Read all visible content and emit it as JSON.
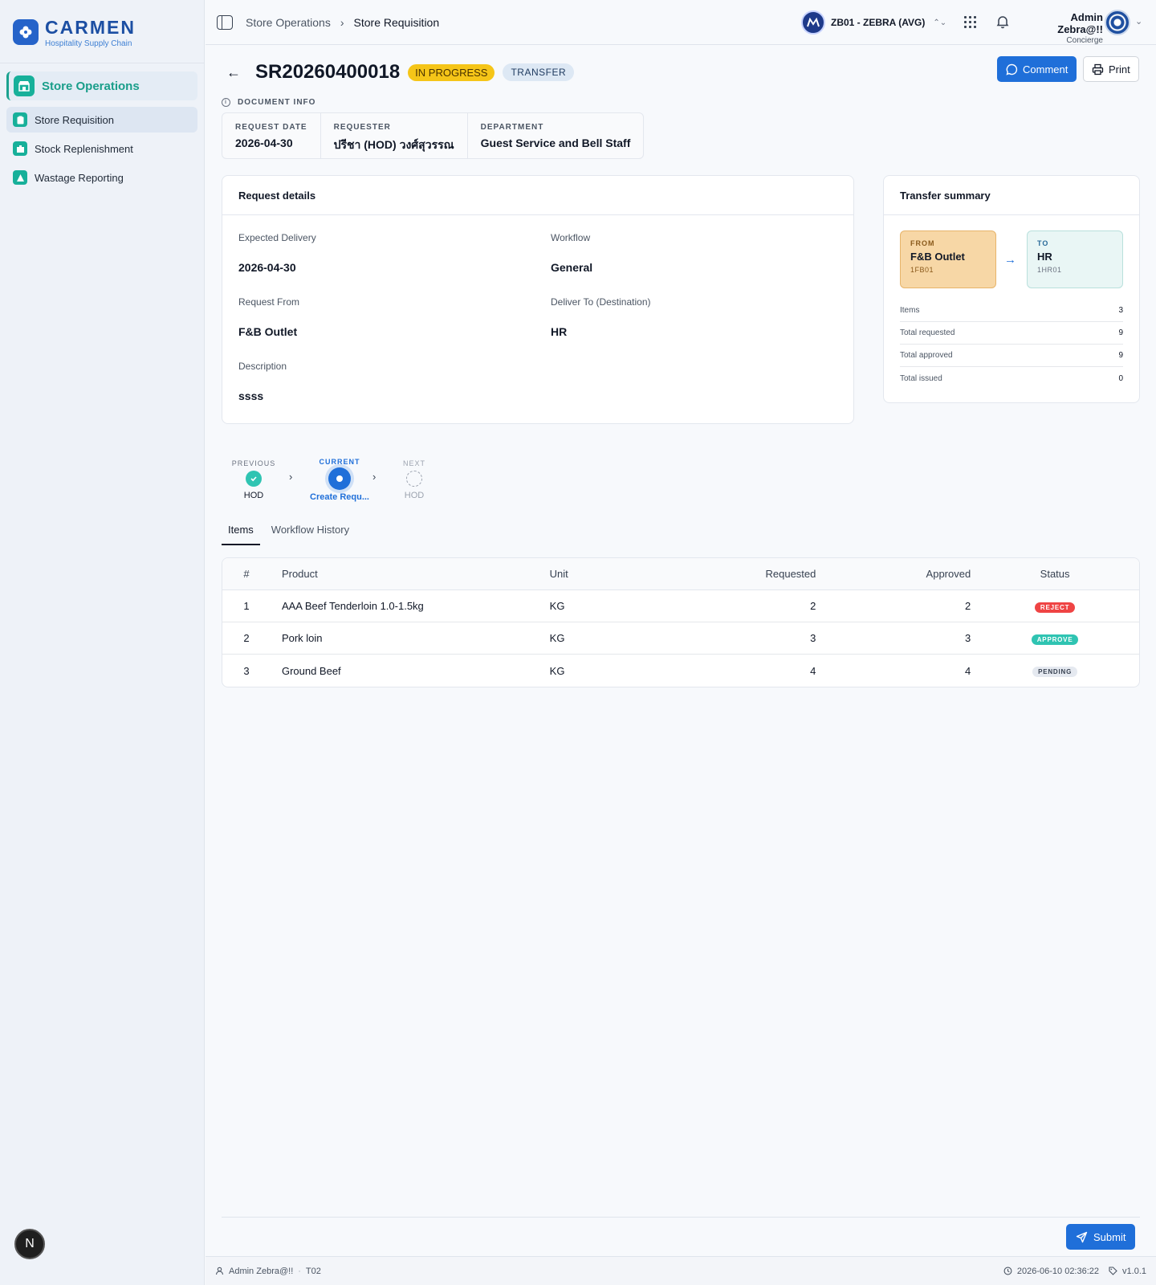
{
  "brand": {
    "name": "CARMEN",
    "subtitle": "Hospitality Supply Chain"
  },
  "sidebar": {
    "module": "Store Operations",
    "items": [
      {
        "label": "Store Requisition",
        "icon": "clipboard-icon",
        "active": true
      },
      {
        "label": "Stock Replenishment",
        "icon": "box-icon",
        "active": false
      },
      {
        "label": "Wastage Reporting",
        "icon": "warning-icon",
        "active": false
      }
    ],
    "avatar_letter": "N"
  },
  "topbar": {
    "breadcrumb": [
      "Store Operations",
      "Store Requisition"
    ],
    "company": "ZB01 - ZEBRA (AVG)",
    "user_name": "Admin Zebra@!!",
    "user_role": "Concierge"
  },
  "document": {
    "number": "SR20260400018",
    "status": "IN PROGRESS",
    "type": "TRANSFER",
    "comment_label": "Comment",
    "print_label": "Print",
    "info_title": "DOCUMENT INFO",
    "info": [
      {
        "label": "REQUEST DATE",
        "value": "2026-04-30"
      },
      {
        "label": "REQUESTER",
        "value": "ปรีชา (HOD) วงศ์สุวรรณ"
      },
      {
        "label": "DEPARTMENT",
        "value": "Guest Service and Bell Staff"
      }
    ]
  },
  "request_details": {
    "title": "Request details",
    "fields": [
      {
        "label": "Expected Delivery",
        "value": "2026-04-30"
      },
      {
        "label": "Workflow",
        "value": "General"
      },
      {
        "label": "Request From",
        "value": "F&B Outlet"
      },
      {
        "label": "Deliver To (Destination)",
        "value": "HR"
      },
      {
        "label": "Description",
        "value": "ssss"
      }
    ]
  },
  "transfer_summary": {
    "title": "Transfer summary",
    "from": {
      "label": "FROM",
      "name": "F&B Outlet",
      "code": "1FB01"
    },
    "to": {
      "label": "TO",
      "name": "HR",
      "code": "1HR01"
    },
    "rows": [
      {
        "label": "Items",
        "value": "3"
      },
      {
        "label": "Total requested",
        "value": "9"
      },
      {
        "label": "Total approved",
        "value": "9"
      },
      {
        "label": "Total issued",
        "value": "0"
      }
    ]
  },
  "workflow": {
    "previous": {
      "label": "PREVIOUS",
      "name": "HOD"
    },
    "current": {
      "label": "CURRENT",
      "name": "Create Requ..."
    },
    "next": {
      "label": "NEXT",
      "name": "HOD"
    }
  },
  "tabs": [
    "Items",
    "Workflow History"
  ],
  "items_table": {
    "headers": [
      "#",
      "Product",
      "Unit",
      "Requested",
      "Approved",
      "Status"
    ],
    "rows": [
      {
        "num": "1",
        "product": "AAA Beef Tenderloin 1.0-1.5kg",
        "unit": "KG",
        "requested": "2",
        "approved": "2",
        "status": "REJECT"
      },
      {
        "num": "2",
        "product": "Pork loin",
        "unit": "KG",
        "requested": "3",
        "approved": "3",
        "status": "APPROVE"
      },
      {
        "num": "3",
        "product": "Ground Beef",
        "unit": "KG",
        "requested": "4",
        "approved": "4",
        "status": "PENDING"
      }
    ]
  },
  "status_colors": {
    "REJECT": "#ef4444",
    "APPROVE": "#2fc4b2",
    "PENDING": "#e5e9f0"
  },
  "submit_label": "Submit",
  "footer": {
    "user": "Admin Zebra@!!",
    "code": "T02",
    "datetime": "2026-06-10 02:36:22",
    "version": "v1.0.1"
  }
}
